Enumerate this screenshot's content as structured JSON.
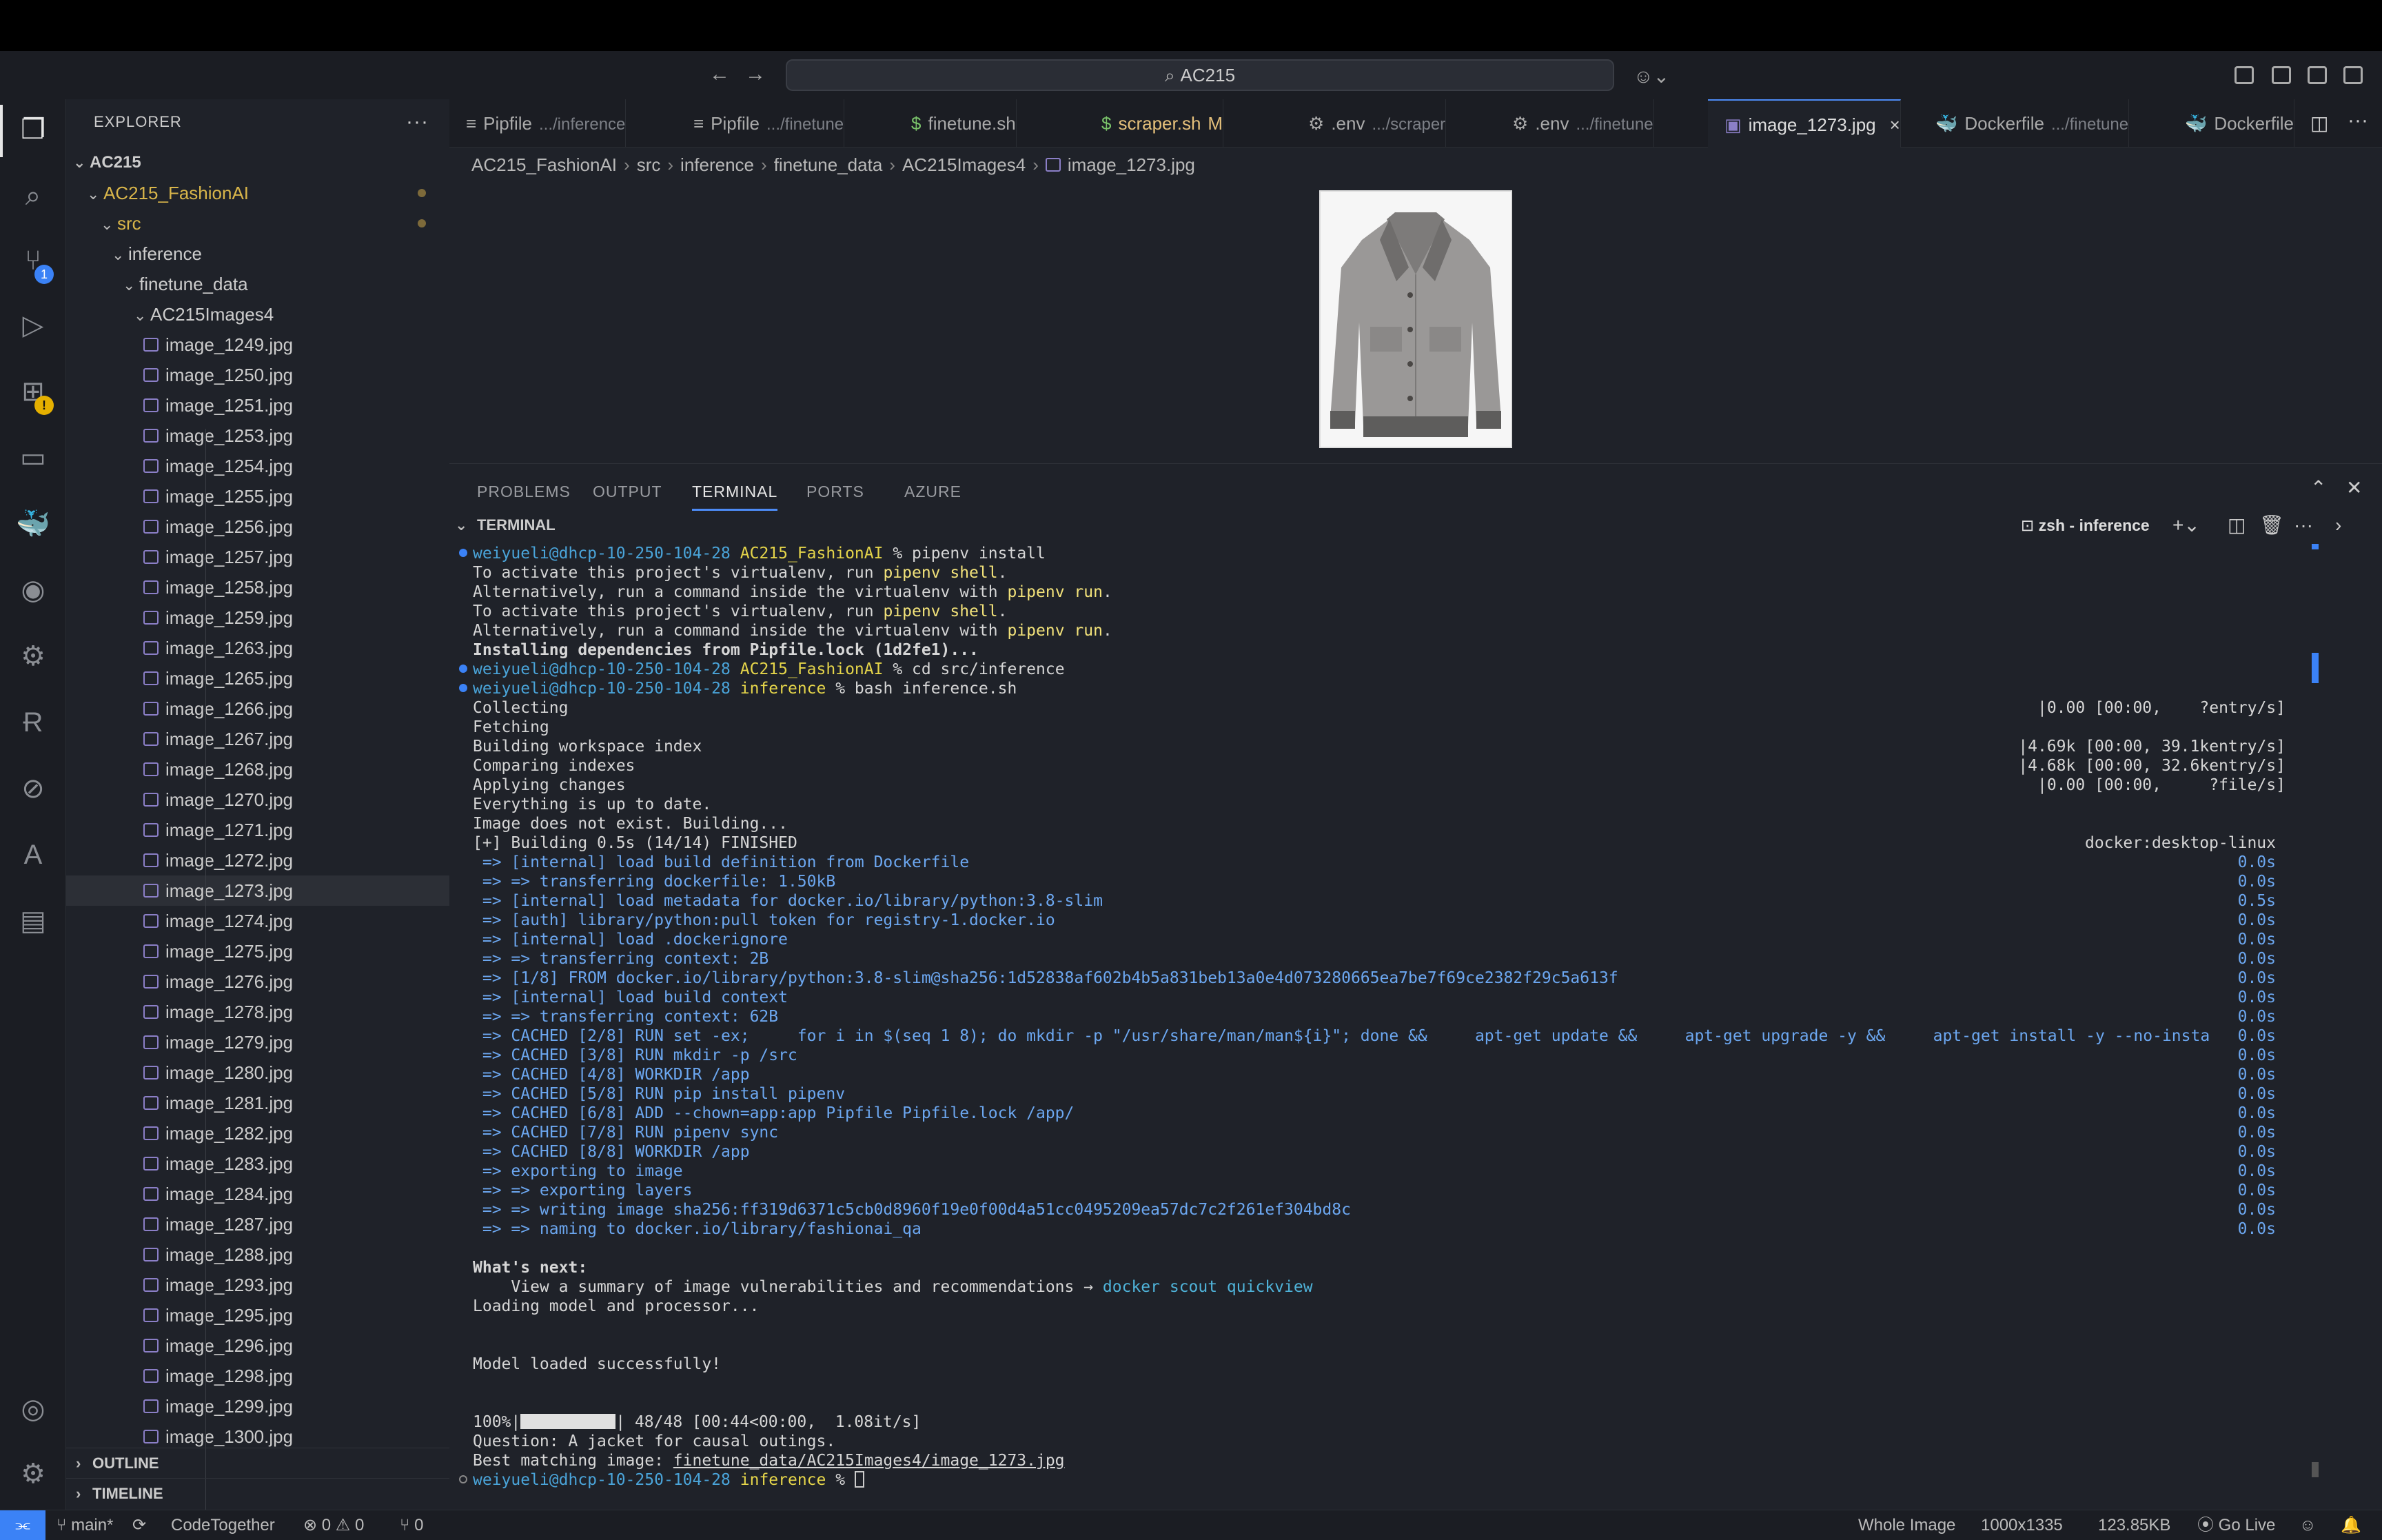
{
  "window": {
    "command_center": "AC215",
    "nav_back": "←",
    "nav_forward": "→"
  },
  "activity_bar": {
    "source_control_badge": "1",
    "extensions_warning_badge": "!"
  },
  "explorer": {
    "title": "EXPLORER",
    "more": "···",
    "root": "AC215",
    "project": "AC215_FashionAI",
    "src": "src",
    "inference": "inference",
    "finetune_data": "finetune_data",
    "images_folder": "AC215Images4",
    "files": [
      "image_1249.jpg",
      "image_1250.jpg",
      "image_1251.jpg",
      "image_1253.jpg",
      "image_1254.jpg",
      "image_1255.jpg",
      "image_1256.jpg",
      "image_1257.jpg",
      "image_1258.jpg",
      "image_1259.jpg",
      "image_1263.jpg",
      "image_1265.jpg",
      "image_1266.jpg",
      "image_1267.jpg",
      "image_1268.jpg",
      "image_1270.jpg",
      "image_1271.jpg",
      "image_1272.jpg",
      "image_1273.jpg",
      "image_1274.jpg",
      "image_1275.jpg",
      "image_1276.jpg",
      "image_1278.jpg",
      "image_1279.jpg",
      "image_1280.jpg",
      "image_1281.jpg",
      "image_1282.jpg",
      "image_1283.jpg",
      "image_1284.jpg",
      "image_1287.jpg",
      "image_1288.jpg",
      "image_1293.jpg",
      "image_1295.jpg",
      "image_1296.jpg",
      "image_1298.jpg",
      "image_1299.jpg",
      "image_1300.jpg"
    ],
    "selected_file": "image_1273.jpg",
    "outline": "OUTLINE",
    "timeline": "TIMELINE"
  },
  "tabs": [
    {
      "icon": "≡",
      "name": "Pipfile",
      "desc": ".../inference"
    },
    {
      "icon": "≡",
      "name": "Pipfile",
      "desc": ".../finetune"
    },
    {
      "icon": "$",
      "name": "finetune.sh",
      "desc": ""
    },
    {
      "icon": "$",
      "name": "scraper.sh",
      "desc": "",
      "modified": "M"
    },
    {
      "icon": "⚙",
      "name": ".env",
      "desc": ".../scraper"
    },
    {
      "icon": "⚙",
      "name": ".env",
      "desc": ".../finetune"
    },
    {
      "icon": "▣",
      "name": "image_1273.jpg",
      "desc": "",
      "close": "×"
    },
    {
      "icon": "🐳",
      "name": "Dockerfile",
      "desc": ".../finetune"
    },
    {
      "icon": "🐳",
      "name": "Dockerfile",
      "desc": ""
    }
  ],
  "breadcrumb": [
    "AC215_FashionAI",
    "src",
    "inference",
    "finetune_data",
    "AC215Images4",
    "image_1273.jpg"
  ],
  "panel": {
    "tabs": [
      "PROBLEMS",
      "OUTPUT",
      "TERMINAL",
      "PORTS",
      "AZURE"
    ],
    "section": "TERMINAL",
    "terminal_name": "zsh - inference"
  },
  "terminal": {
    "user": "weiyueli",
    "host": "@dhcp-10-250-104-28",
    "dir_project": "AC215_FashionAI",
    "dir_inference": "inference",
    "cmd1": " % pipenv install",
    "l2a": "To activate this project's virtualenv, run ",
    "l2b": "pipenv shell",
    "l2c": ".",
    "l3a": "Alternatively, run a command inside the virtualenv with ",
    "l3b": "pipenv run",
    "l3c": ".",
    "l6": "Installing dependencies from Pipfile.lock (1d2fe1)...",
    "cmd2": " % cd src/inference",
    "cmd3": " % bash inference.sh",
    "collecting": "Collecting",
    "collecting_r": "|0.00 [00:00,    ?entry/s]",
    "fetching": "Fetching",
    "building_idx": "Building workspace index",
    "building_idx_r": "|4.69k [00:00, 39.1kentry/s]",
    "comparing": "Comparing indexes",
    "comparing_r": "|4.68k [00:00, 32.6kentry/s]",
    "applying": "Applying changes",
    "applying_r": "|0.00 [00:00,     ?file/s]",
    "uptodate": "Everything is up to date.",
    "building_img": "Image does not exist. Building...",
    "build_head": "[+] Building 0.5s (14/14) FINISHED",
    "build_head_r": "docker:desktop-linux",
    "steps": [
      {
        "t": " => [internal] load build definition from Dockerfile",
        "r": "0.0s"
      },
      {
        "t": " => => transferring dockerfile: 1.50kB",
        "r": "0.0s"
      },
      {
        "t": " => [internal] load metadata for docker.io/library/python:3.8-slim",
        "r": "0.5s"
      },
      {
        "t": " => [auth] library/python:pull token for registry-1.docker.io",
        "r": "0.0s"
      },
      {
        "t": " => [internal] load .dockerignore",
        "r": "0.0s"
      },
      {
        "t": " => => transferring context: 2B",
        "r": "0.0s"
      },
      {
        "t": " => [1/8] FROM docker.io/library/python:3.8-slim@sha256:1d52838af602b4b5a831beb13a0e4d073280665ea7be7f69ce2382f29c5a613f",
        "r": "0.0s"
      },
      {
        "t": " => [internal] load build context",
        "r": "0.0s"
      },
      {
        "t": " => => transferring context: 62B",
        "r": "0.0s"
      },
      {
        "t": " => CACHED [2/8] RUN set -ex;     for i in $(seq 1 8); do mkdir -p \"/usr/share/man/man${i}\"; done &&     apt-get update &&     apt-get upgrade -y &&     apt-get install -y --no-insta",
        "r": "0.0s"
      },
      {
        "t": " => CACHED [3/8] RUN mkdir -p /src",
        "r": "0.0s"
      },
      {
        "t": " => CACHED [4/8] WORKDIR /app",
        "r": "0.0s"
      },
      {
        "t": " => CACHED [5/8] RUN pip install pipenv",
        "r": "0.0s"
      },
      {
        "t": " => CACHED [6/8] ADD --chown=app:app Pipfile Pipfile.lock /app/",
        "r": "0.0s"
      },
      {
        "t": " => CACHED [7/8] RUN pipenv sync",
        "r": "0.0s"
      },
      {
        "t": " => CACHED [8/8] WORKDIR /app",
        "r": "0.0s"
      },
      {
        "t": " => exporting to image",
        "r": "0.0s"
      },
      {
        "t": " => => exporting layers",
        "r": "0.0s"
      },
      {
        "t": " => => writing image sha256:ff319d6371c5cb0d8960f19e0f00d4a51cc0495209ea57dc7c2f261ef304bd8c",
        "r": "0.0s"
      },
      {
        "t": " => => naming to docker.io/library/fashionai_qa",
        "r": "0.0s"
      }
    ],
    "whats_next": "What's next:",
    "summary_a": "    View a summary of image vulnerabilities and recommendations → ",
    "summary_b": "docker scout quickview",
    "loading": "Loading model and processor...",
    "loaded": "Model loaded successfully!",
    "progress_a": "100%|",
    "progress_b": "| 48/48 [00:44<00:00,  1.08it/s]",
    "question": "Question: A jacket for causal outings.",
    "best_a": "Best matching image: ",
    "best_b": "finetune_data/AC215Images4/image_1273.jpg",
    "final_prompt": " % "
  },
  "statusbar": {
    "branch": "main*",
    "sync": "⟳",
    "codetogether": "CodeTogether",
    "problems": "⊗ 0 ⚠ 0",
    "ports": "⑂ 0",
    "whole_image": "Whole Image",
    "dimensions": "1000x1335",
    "filesize": "123.85KB",
    "golive": "Go Live"
  }
}
